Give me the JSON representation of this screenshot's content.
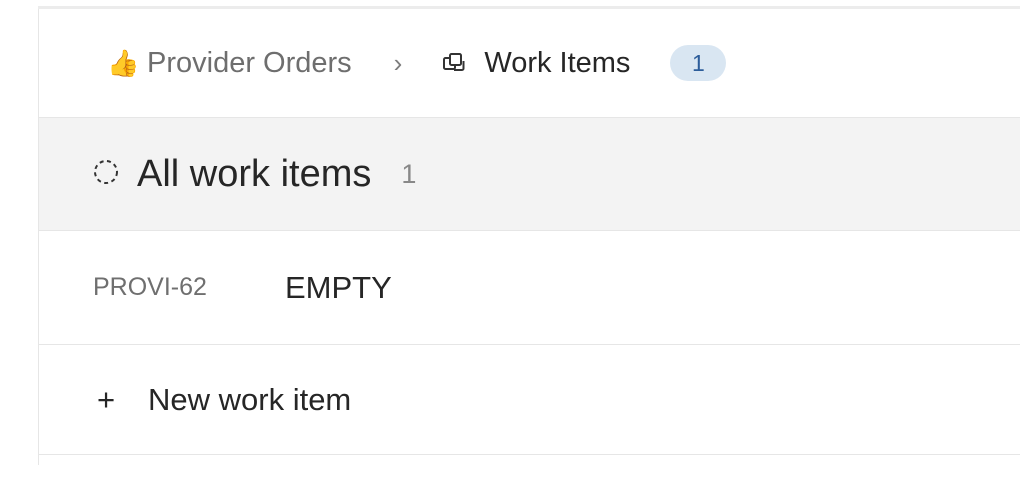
{
  "breadcrumb": {
    "parent_icon": "thumbs-up-icon",
    "parent_label": "Provider Orders",
    "separator_icon": "chevron-right-icon",
    "current_icon": "work-items-stack-icon",
    "current_label": "Work Items",
    "count": "1"
  },
  "group": {
    "status_icon": "dashed-circle-icon",
    "title": "All work items",
    "count": "1"
  },
  "items": [
    {
      "id": "PROVI-62",
      "title": "EMPTY"
    }
  ],
  "new_item": {
    "icon": "plus-icon",
    "label": "New work item"
  },
  "colors": {
    "group_background": "#f3f3f3",
    "badge_background": "#d9e6f2",
    "badge_text": "#2c5d9a",
    "muted_text": "#6e6e6e"
  }
}
